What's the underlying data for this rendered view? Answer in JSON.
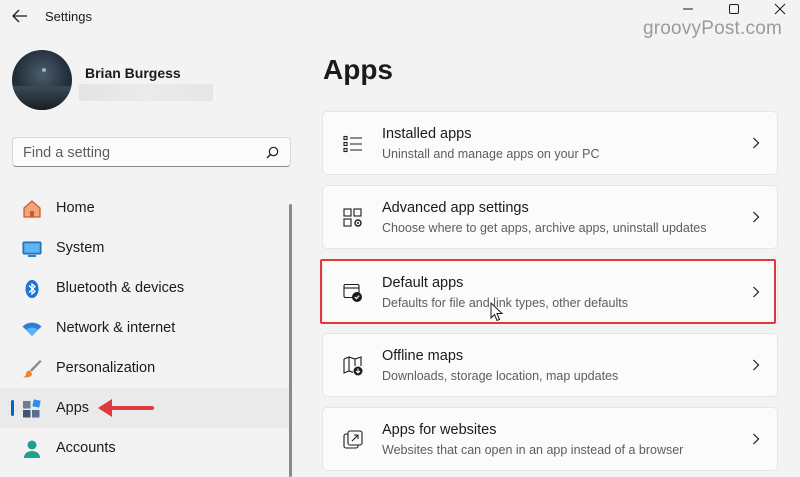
{
  "window": {
    "title": "Settings",
    "watermark": "groovyPost.com"
  },
  "profile": {
    "name": "Brian Burgess"
  },
  "search": {
    "placeholder": "Find a setting"
  },
  "nav": {
    "items": [
      {
        "label": "Home",
        "icon": "home-icon"
      },
      {
        "label": "System",
        "icon": "system-icon"
      },
      {
        "label": "Bluetooth & devices",
        "icon": "bluetooth-icon"
      },
      {
        "label": "Network & internet",
        "icon": "wifi-icon"
      },
      {
        "label": "Personalization",
        "icon": "brush-icon"
      },
      {
        "label": "Apps",
        "icon": "apps-icon",
        "active": true
      },
      {
        "label": "Accounts",
        "icon": "accounts-icon"
      }
    ]
  },
  "main": {
    "title": "Apps",
    "cards": [
      {
        "title": "Installed apps",
        "desc": "Uninstall and manage apps on your PC",
        "icon": "installed-apps-icon"
      },
      {
        "title": "Advanced app settings",
        "desc": "Choose where to get apps, archive apps, uninstall updates",
        "icon": "advanced-apps-icon"
      },
      {
        "title": "Default apps",
        "desc": "Defaults for file and link types, other defaults",
        "icon": "default-apps-icon",
        "highlighted": true
      },
      {
        "title": "Offline maps",
        "desc": "Downloads, storage location, map updates",
        "icon": "offline-maps-icon"
      },
      {
        "title": "Apps for websites",
        "desc": "Websites that can open in an app instead of a browser",
        "icon": "apps-for-websites-icon"
      }
    ]
  },
  "colors": {
    "accent": "#0067c0",
    "annotation_red": "#e0383f",
    "background": "#f3f3f3",
    "card": "#fbfbfb"
  }
}
